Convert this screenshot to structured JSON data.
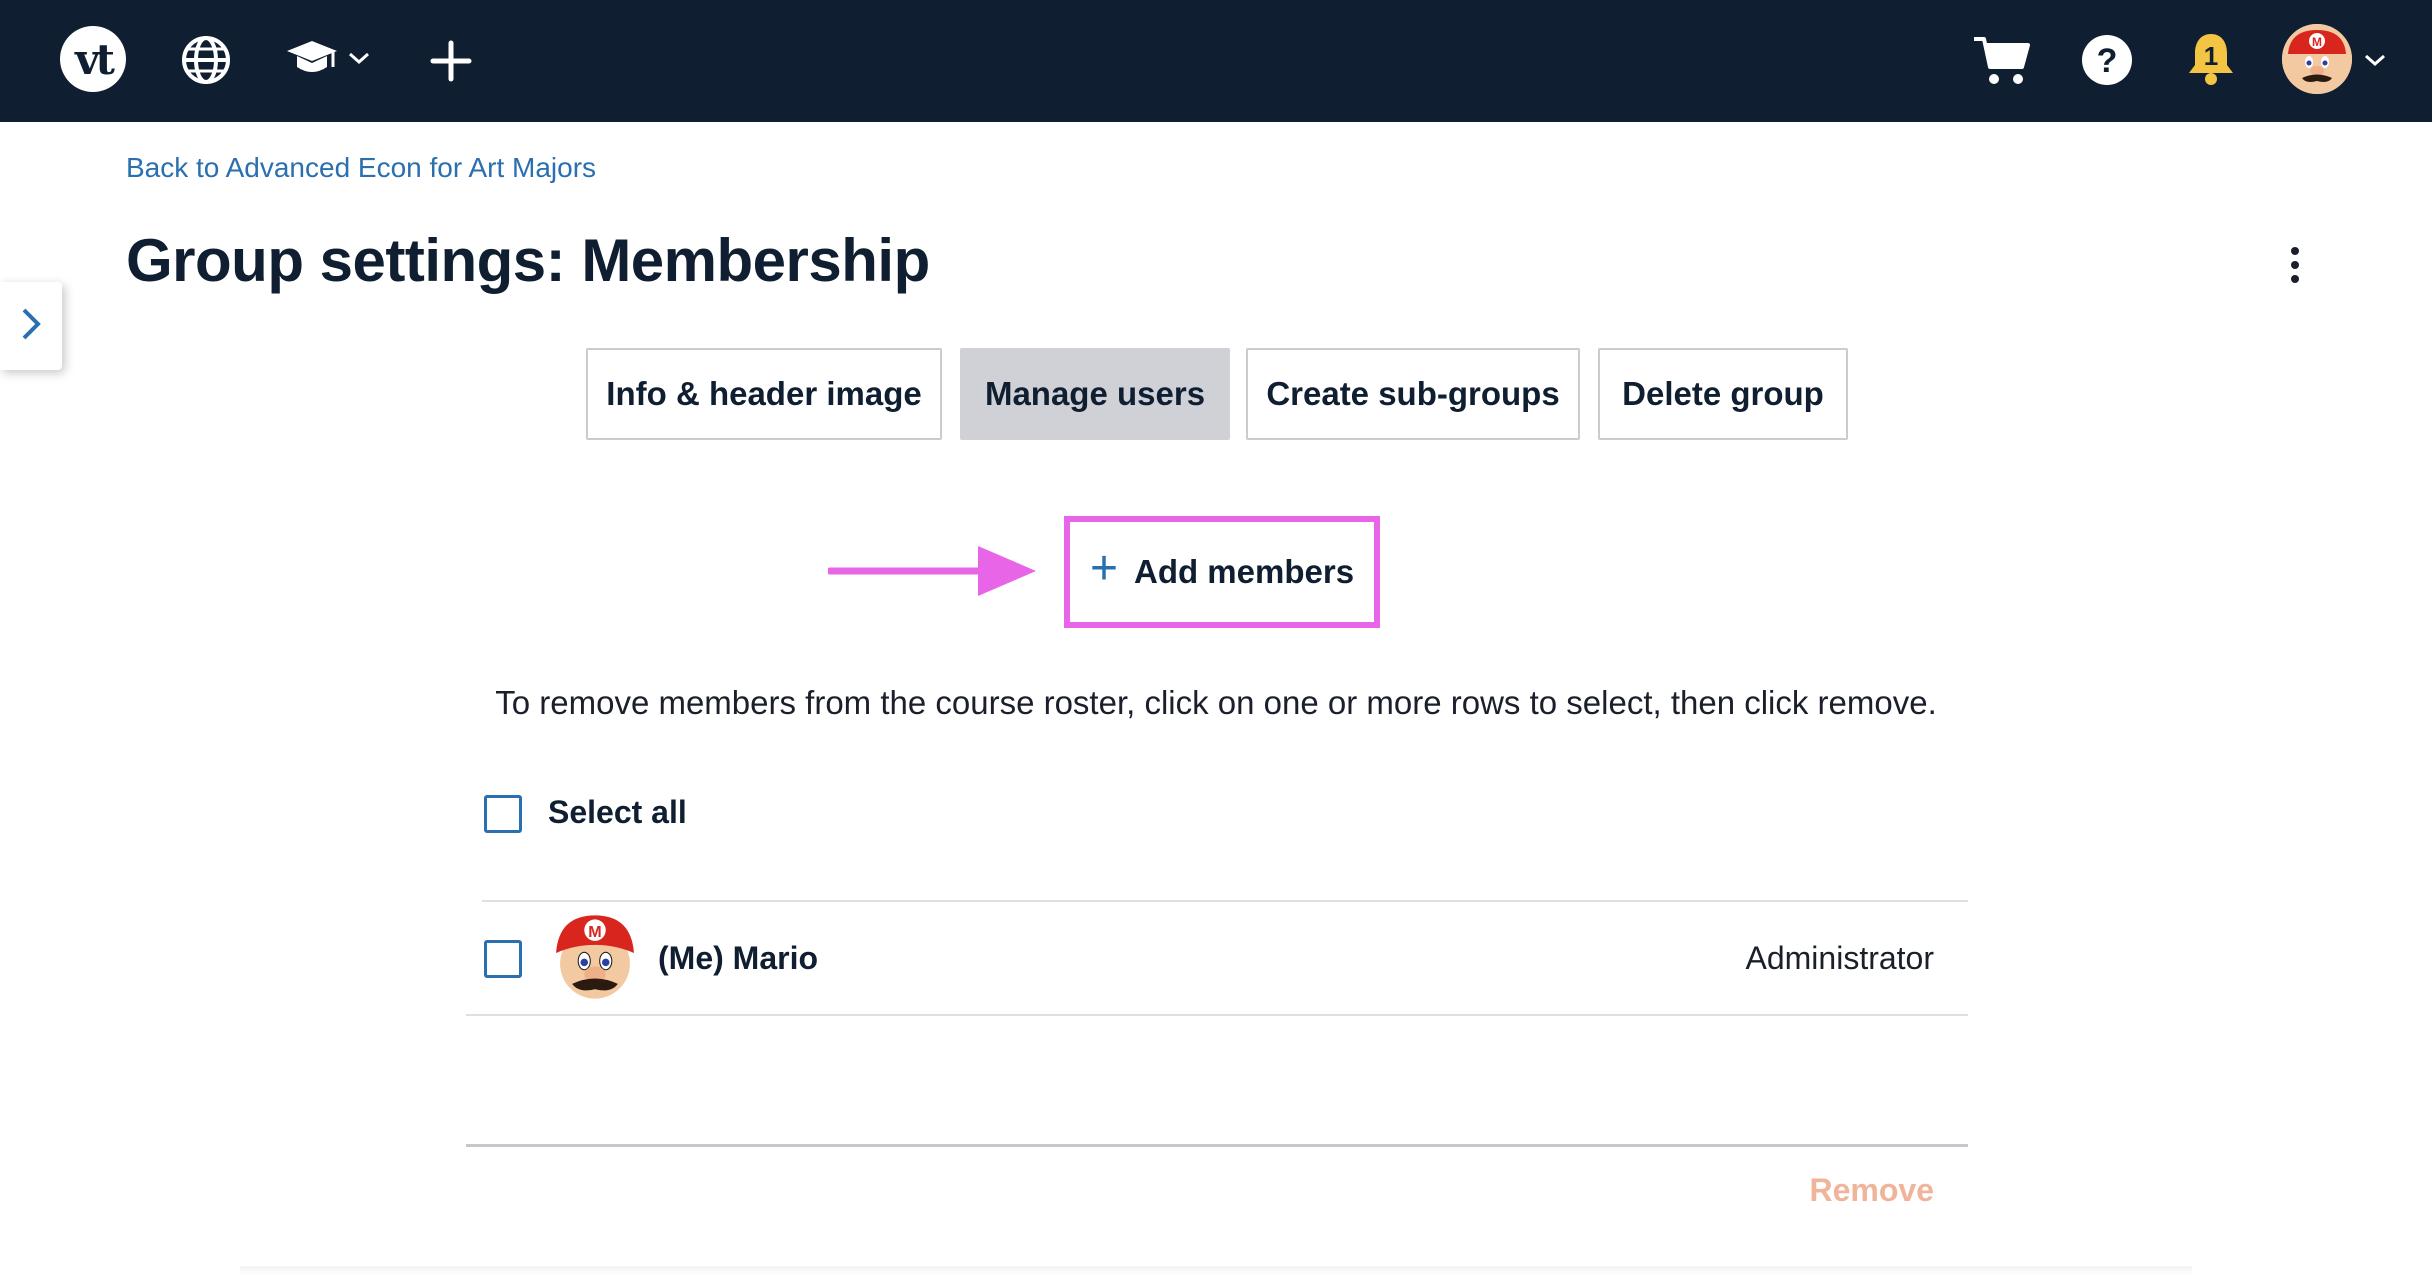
{
  "navbar": {
    "logo_text": "vt",
    "icons": [
      "globe-icon",
      "graduation-cap-icon",
      "chevron-down-icon",
      "plus-icon",
      "cart-icon",
      "help-icon",
      "bell-icon",
      "avatar",
      "chevron-down-icon"
    ],
    "bell_badge": "1",
    "help_glyph": "?",
    "background": "#0f1e30"
  },
  "breadcrumb": {
    "back_label": "Back to Advanced Econ for Art Majors"
  },
  "page": {
    "title": "Group settings: Membership"
  },
  "tabs": [
    {
      "label": "Info & header image",
      "active": false
    },
    {
      "label": "Manage users",
      "active": true
    },
    {
      "label": "Create sub-groups",
      "active": false
    },
    {
      "label": "Delete group",
      "active": false
    }
  ],
  "actions": {
    "add_members_label": "Add members",
    "add_members_plus": "+",
    "highlight_color": "#e865e8"
  },
  "instructions": "To remove members from the course roster, click on one or more rows to select, then click remove.",
  "roster": {
    "select_all_label": "Select all",
    "members": [
      {
        "name": "(Me) Mario",
        "role": "Administrator"
      }
    ],
    "remove_label": "Remove"
  },
  "colors": {
    "link": "#2a6fb0",
    "remove_disabled": "#efb59b"
  }
}
